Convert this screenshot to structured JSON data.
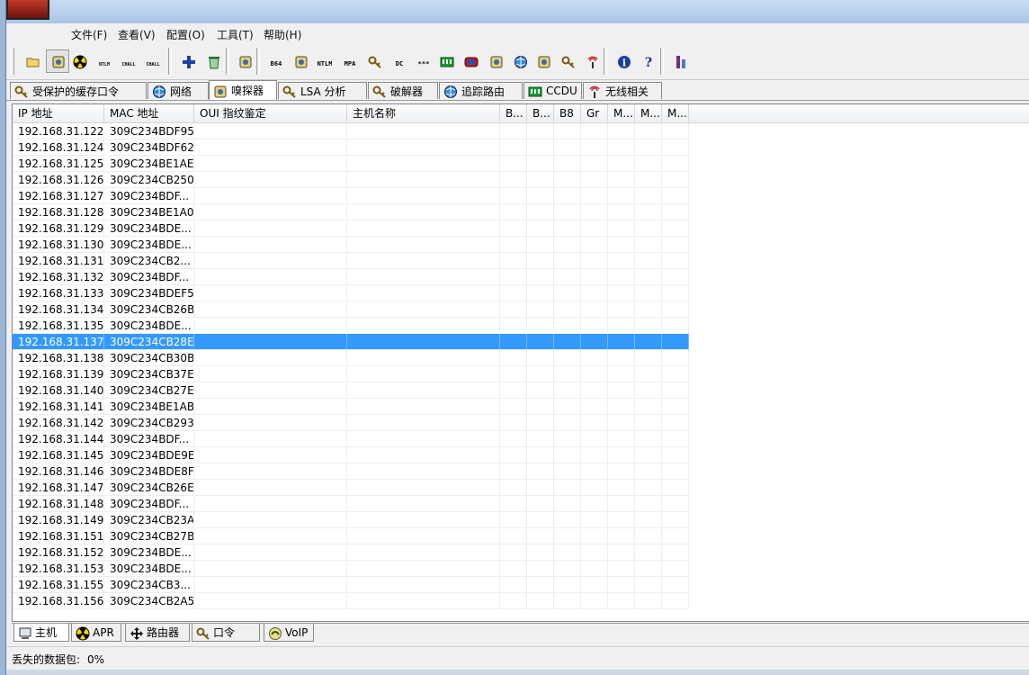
{
  "menu": [
    "文件(F)",
    "查看(V)",
    "配置(O)",
    "工具(T)",
    "帮助(H)"
  ],
  "toolbar": {
    "buttons": [
      {
        "icon": "open-folder-icon"
      },
      {
        "icon": "sniffer-icon",
        "pressed": true
      },
      {
        "icon": "radioactive-apr-icon"
      },
      {
        "icon": "ntlm-auth-icon",
        "label": "NTLM AUTH"
      },
      {
        "icon": "chall-spoof-reset-icon",
        "label": "CHALL SPOOF RESET"
      },
      {
        "icon": "chall-spoof-ntlm-icon",
        "label": "CHALL SPOOF NTLM"
      },
      {
        "icon": "add-plus-icon"
      },
      {
        "icon": "recycle-bin-icon"
      },
      {
        "icon": "scan-icon"
      },
      {
        "icon": "base64-icon",
        "label": "B64"
      },
      {
        "icon": "hash-calculator-icon"
      },
      {
        "icon": "lm-hash-icon",
        "label": "NTLM"
      },
      {
        "icon": "mpa-icon",
        "label": "MPA"
      },
      {
        "icon": "key-icon"
      },
      {
        "icon": "dc-icon",
        "label": "DC"
      },
      {
        "icon": "password-field-icon",
        "label": "***"
      },
      {
        "icon": "network-card-icon"
      },
      {
        "icon": "remote-desktop-icon"
      },
      {
        "icon": "home-network-icon"
      },
      {
        "icon": "globe-icon"
      },
      {
        "icon": "certificate-icon"
      },
      {
        "icon": "key-lock-icon"
      },
      {
        "icon": "wireless-icon"
      },
      {
        "icon": "info-icon"
      },
      {
        "icon": "help-icon"
      },
      {
        "icon": "user-pillar-icon"
      }
    ]
  },
  "top_tabs": [
    {
      "icon": "key-cache-icon",
      "label": "受保护的缓存口令"
    },
    {
      "icon": "network-globe-icon",
      "label": "网络"
    },
    {
      "icon": "sniffer-tab-icon",
      "label": "嗅探器",
      "active": true
    },
    {
      "icon": "lsa-icon",
      "label": "LSA 分析"
    },
    {
      "icon": "cracker-key-icon",
      "label": "破解器"
    },
    {
      "icon": "traceroute-icon",
      "label": "追踪路由"
    },
    {
      "icon": "ccdu-icon",
      "label": "CCDU"
    },
    {
      "icon": "wireless-tab-icon",
      "label": "无线相关"
    }
  ],
  "columns": [
    "IP 地址",
    "MAC 地址",
    "OUI 指纹鉴定",
    "主机名称",
    "B...",
    "B...",
    "B8",
    "Gr",
    "M...",
    "M...",
    "M..."
  ],
  "rows": [
    [
      "192.168.31.122",
      "309C234BDF95"
    ],
    [
      "192.168.31.124",
      "309C234BDF62"
    ],
    [
      "192.168.31.125",
      "309C234BE1AE"
    ],
    [
      "192.168.31.126",
      "309C234CB250"
    ],
    [
      "192.168.31.127",
      "309C234BDF..."
    ],
    [
      "192.168.31.128",
      "309C234BE1A0"
    ],
    [
      "192.168.31.129",
      "309C234BDE..."
    ],
    [
      "192.168.31.130",
      "309C234BDE..."
    ],
    [
      "192.168.31.131",
      "309C234CB2..."
    ],
    [
      "192.168.31.132",
      "309C234BDF..."
    ],
    [
      "192.168.31.133",
      "309C234BDEF5"
    ],
    [
      "192.168.31.134",
      "309C234CB26B"
    ],
    [
      "192.168.31.135",
      "309C234BDE..."
    ],
    [
      "192.168.31.137",
      "309C234CB28E"
    ],
    [
      "192.168.31.138",
      "309C234CB30B"
    ],
    [
      "192.168.31.139",
      "309C234CB37E"
    ],
    [
      "192.168.31.140",
      "309C234CB27E"
    ],
    [
      "192.168.31.141",
      "309C234BE1AB"
    ],
    [
      "192.168.31.142",
      "309C234CB293"
    ],
    [
      "192.168.31.144",
      "309C234BDF..."
    ],
    [
      "192.168.31.145",
      "309C234BDE9E"
    ],
    [
      "192.168.31.146",
      "309C234BDE8F"
    ],
    [
      "192.168.31.147",
      "309C234CB26E"
    ],
    [
      "192.168.31.148",
      "309C234BDF..."
    ],
    [
      "192.168.31.149",
      "309C234CB23A"
    ],
    [
      "192.168.31.151",
      "309C234CB27B"
    ],
    [
      "192.168.31.152",
      "309C234BDE..."
    ],
    [
      "192.168.31.153",
      "309C234BDE..."
    ],
    [
      "192.168.31.155",
      "309C234CB3..."
    ],
    [
      "192.168.31.156",
      "309C234CB2A5"
    ]
  ],
  "selected_row_ip": "192.168.31.137",
  "bottom_tabs": [
    {
      "icon": "host-computer-icon",
      "label": "主机",
      "active": true
    },
    {
      "icon": "apr-radioactive-icon",
      "label": "APR"
    },
    {
      "icon": "router-arrows-icon",
      "label": "路由器"
    },
    {
      "icon": "password-keys-icon",
      "label": "口令"
    },
    {
      "icon": "voip-icon",
      "label": "VoIP"
    }
  ],
  "status": {
    "label": "丢失的数据包:",
    "value": "0%"
  },
  "colors": {
    "selection": "#3399ff",
    "titlebar": "#a9c4e6"
  }
}
